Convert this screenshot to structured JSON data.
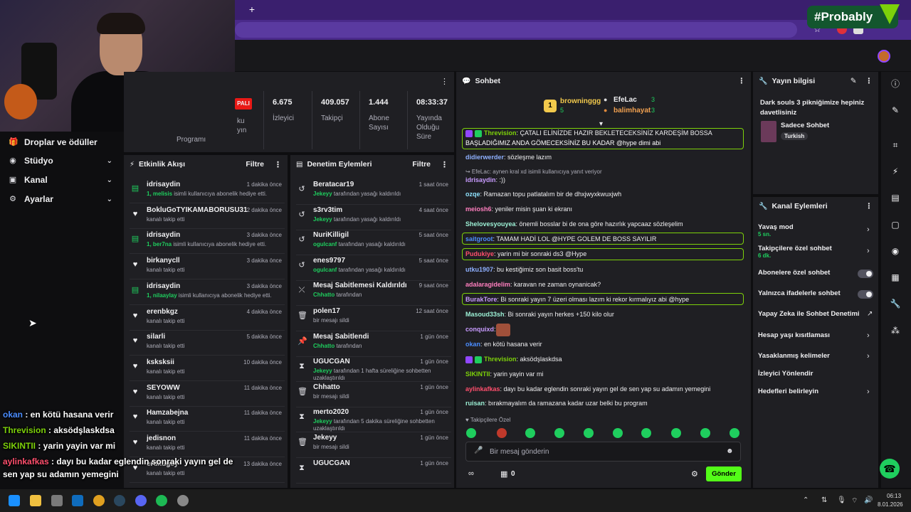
{
  "browser": {
    "new_tab_label": "+"
  },
  "brand_overlay": {
    "text": "#Probably"
  },
  "nav": [
    {
      "label": "Droplar ve ödüller",
      "icon": "gift-icon"
    },
    {
      "label": "Stüdyo",
      "icon": "camera-icon"
    },
    {
      "label": "Kanal",
      "icon": "channel-icon"
    },
    {
      "label": "Ayarlar",
      "icon": "gear-icon"
    }
  ],
  "overlay_chat": [
    {
      "user": "okan",
      "text": " : en kötü hasana verir",
      "color": "#4b8dff"
    },
    {
      "user": "Threvision",
      "text": " : aksödşlaskdsa",
      "color": "#7dd10a"
    },
    {
      "user": "SIKINTII",
      "text": " : yarin yayin var mi",
      "color": "#7dd10a"
    },
    {
      "user": "aylinkafkas",
      "text": " : dayı bu kadar eglendin sonraki yayın gel de",
      "color": "#ff4f6d"
    },
    {
      "user": "",
      "text": "sen yap su adamın yemegini",
      "color": "#fff"
    }
  ],
  "stats": {
    "status": "PALI",
    "status_sub1": "ku",
    "status_sub2": "yın",
    "program": "Programı",
    "items": [
      {
        "value": "6.675",
        "label": "İzleyici"
      },
      {
        "value": "409.057",
        "label": "Takipçi"
      },
      {
        "value": "1.444",
        "label": "Abone Sayısı"
      },
      {
        "value": "08:33:37",
        "label": "Yayında Olduğu Süre"
      }
    ]
  },
  "activity": {
    "title": "Etkinlik Akışı",
    "filter": "Filtre",
    "items": [
      {
        "name": "idrisaydin",
        "time": "1 dakika önce",
        "hl": "1, melisis",
        "desc": " isimli kullanıcıya abonelik hediye etti.",
        "type": "gift"
      },
      {
        "name": "BokluGoTYIKAMABORUSU31",
        "time": "2 dakika önce",
        "hl": "",
        "desc": "kanalı takip etti",
        "type": "heart"
      },
      {
        "name": "idrisaydin",
        "time": "3 dakika önce",
        "hl": "1, ber7na",
        "desc": " isimli kullanıcıya abonelik hediye etti.",
        "type": "gift"
      },
      {
        "name": "birkanycll",
        "time": "3 dakika önce",
        "hl": "",
        "desc": "kanalı takip etti",
        "type": "heart"
      },
      {
        "name": "idrisaydin",
        "time": "3 dakika önce",
        "hl": "1, nilaaylay",
        "desc": " isimli kullanıcıya abonelik hediye etti.",
        "type": "gift"
      },
      {
        "name": "erenbkgz",
        "time": "4 dakika önce",
        "hl": "",
        "desc": "kanalı takip etti",
        "type": "heart"
      },
      {
        "name": "silarli",
        "time": "5 dakika önce",
        "hl": "",
        "desc": "kanalı takip etti",
        "type": "heart"
      },
      {
        "name": "ksksksii",
        "time": "10 dakika önce",
        "hl": "",
        "desc": "kanalı takip etti",
        "type": "heart"
      },
      {
        "name": "SEYOWW",
        "time": "11 dakika önce",
        "hl": "",
        "desc": "kanalı takip etti",
        "type": "heart"
      },
      {
        "name": "Hamzabejna",
        "time": "11 dakika önce",
        "hl": "",
        "desc": "kanalı takip etti",
        "type": "heart"
      },
      {
        "name": "jedisnon",
        "time": "11 dakika önce",
        "hl": "",
        "desc": "kanalı takip etti",
        "type": "heart"
      },
      {
        "name": "erdkugsy",
        "time": "13 dakika önce",
        "hl": "",
        "desc": "kanalı takip etti",
        "type": "heart"
      }
    ]
  },
  "mod": {
    "title": "Denetim Eylemleri",
    "filter": "Filtre",
    "items": [
      {
        "name": "Beratacar19",
        "time": "1 saat önce",
        "by": "Jekeyy",
        "desc": " tarafından yasağı kaldırıldı",
        "icon": "undo-icon"
      },
      {
        "name": "s3rv3tim",
        "time": "4 saat önce",
        "by": "Jekeyy",
        "desc": " tarafından yasağı kaldırıldı",
        "icon": "undo-icon"
      },
      {
        "name": "NuriKilligil",
        "time": "5 saat önce",
        "by": "ogulcanf",
        "desc": " tarafından yasağı kaldırıldı",
        "icon": "undo-icon"
      },
      {
        "name": "enes9797",
        "time": "5 saat önce",
        "by": "ogulcanf",
        "desc": " tarafından yasağı kaldırıldı",
        "icon": "undo-icon"
      },
      {
        "name": "Mesaj Sabitlemesi Kaldırıldı",
        "time": "9 saat önce",
        "by": "Chhatto",
        "desc": " tarafından",
        "icon": "unpin-icon"
      },
      {
        "name": "polen17",
        "time": "12 saat önce",
        "by": "",
        "desc": "bir mesajı sildi",
        "icon": "trash-icon"
      },
      {
        "name": "Mesaj Sabitlendi",
        "time": "1 gün önce",
        "by": "Chhatto",
        "desc": " tarafından",
        "icon": "pin-icon"
      },
      {
        "name": "UGUCGAN",
        "time": "1 gün önce",
        "by": "Jekeyy",
        "desc": " tarafından 1 hafta süreliğine sohbetten uzaklaştırıldı",
        "icon": "hourglass-icon"
      },
      {
        "name": "Chhatto",
        "time": "1 gün önce",
        "by": "",
        "desc": "bir mesajı sildi",
        "icon": "trash-icon"
      },
      {
        "name": "merto2020",
        "time": "1 gün önce",
        "by": "Jekeyy",
        "desc": " tarafından 5 dakika süreliğine sohbetten uzaklaştırıldı",
        "icon": "hourglass-icon"
      },
      {
        "name": "Jekeyy",
        "time": "1 gün önce",
        "by": "",
        "desc": "bir mesajı sildi",
        "icon": "trash-icon"
      },
      {
        "name": "UGUCGAN",
        "time": "1 gün önce",
        "by": "",
        "desc": "",
        "icon": "hourglass-icon"
      }
    ]
  },
  "chat": {
    "title": "Sohbet",
    "top_gifters": [
      {
        "name": "browninggg",
        "count": "5",
        "rank": "1"
      },
      {
        "name": "EfeLac",
        "count": "3"
      },
      {
        "name": "balimhayat",
        "count": "3"
      }
    ],
    "messages": [
      {
        "user": "Threvision",
        "color": "#7dd10a",
        "text": ": ÇATALI ELİNİZDE HAZIR BEKLETECEKSİNİZ KARDEŞİM BOSSA",
        "hl": true
      },
      {
        "user": "",
        "color": "#fff",
        "text": "BAŞLADIĞIMIZ ANDA GÖMECEKSİNİZ BU KADAR @hype dimi abi",
        "hl": true
      },
      {
        "user": "didierwerder",
        "color": "#8fb0ff",
        "text": ": sözleşme lazım"
      },
      {
        "user": "",
        "color": "#adadb8",
        "text": "↪ EfeLac: aynen kral xd isimli kullanıcıya yanıt veriyor",
        "small": true
      },
      {
        "user": "idrisaydin",
        "color": "#c89bff",
        "text": ": :))"
      },
      {
        "user": "ozqe",
        "color": "#8fe3ff",
        "text": ": Ramazan topu patlatalım bir de dhxjwyxkwuxjwh"
      },
      {
        "user": "meiosh6",
        "color": "#ff7fbf",
        "text": ": yeniler misin şuan ki ekranı"
      },
      {
        "user": "Shelovesyouyea",
        "color": "#9cf0d5",
        "text": ": önemli bosslar bi de ona göre hazırlık yapcaaz sözleşelim"
      },
      {
        "user": "saitgroot",
        "color": "#4b8dff",
        "text": ": TAMAM HADİ LOL @HYPE GOLEM DE BOSS SAYILIR",
        "hl": true
      },
      {
        "user": "Pudukiye",
        "color": "#ff4f6d",
        "text": ": yarin mi bir sonraki ds3 @Hype",
        "hl": true
      },
      {
        "user": "utku1907",
        "color": "#8fb0ff",
        "text": ": bu kestiğimiz son basit boss'tu"
      },
      {
        "user": "adalaragidelim",
        "color": "#ff7fbf",
        "text": ": karavan ne zaman oynanicak?"
      },
      {
        "user": "BurakTore",
        "color": "#c89bff",
        "text": ": Bi sonraki yayın 7 üzeri olması lazım ki rekor kırmalıyız abi @hype",
        "hl": true
      },
      {
        "user": "Masoud33sh",
        "color": "#9cf0d5",
        "text": ": Bi sonraki yayın herkes +150 kilo olur"
      },
      {
        "user": "conquixd",
        "color": "#c89bff",
        "text": ":"
      },
      {
        "user": "okan",
        "color": "#4b8dff",
        "text": ": en kötü hasana verir"
      },
      {
        "user": "Threvision",
        "color": "#7dd10a",
        "text": ": aksödşlaskdsa"
      },
      {
        "user": "SIKINTII",
        "color": "#7dd10a",
        "text": ": yarin yayin var mi"
      },
      {
        "user": "aylinkafkas",
        "color": "#ff4f6d",
        "text": ": dayı bu kadar eglendin sonraki yayın gel de sen yap su adamın yemegini"
      },
      {
        "user": "ruisan",
        "color": "#9cf0d5",
        "text": ": bırakmayalım da ramazana kadar uzar belki bu program"
      }
    ],
    "followers_only": "Takipçilere Özel",
    "input_placeholder": "Bir mesaj gönderin",
    "points": "0",
    "send_label": "Gönder"
  },
  "stream_info": {
    "title": "Yayın bilgisi",
    "stream_title": "Dark souls 3 pikniğimize hepiniz davetlisiniz",
    "category": "Sadece Sohbet",
    "tag": "Turkish"
  },
  "channel_actions": {
    "title": "Kanal Eylemleri",
    "items": [
      {
        "label": "Yavaş mod",
        "sub": "5 sn.",
        "ctrl": "chevron"
      },
      {
        "label": "Takipçilere özel sohbet",
        "sub": "6 dk.",
        "ctrl": "chevron"
      },
      {
        "label": "Abonelere özel sohbet",
        "sub": "",
        "ctrl": "toggle"
      },
      {
        "label": "Yalnızca ifadelerle sohbet",
        "sub": "",
        "ctrl": "toggle"
      },
      {
        "label": "Yapay Zeka ile Sohbet Denetimi",
        "sub": "",
        "ctrl": "external"
      },
      {
        "label": "Hesap yaşı kısıtlaması",
        "sub": "",
        "ctrl": "chevron"
      },
      {
        "label": "Yasaklanmış kelimeler",
        "sub": "",
        "ctrl": "chevron"
      },
      {
        "label": "İzleyici Yönlendir",
        "sub": "",
        "ctrl": "none"
      },
      {
        "label": "Hedefleri belirleyin",
        "sub": "",
        "ctrl": "chevron"
      }
    ]
  },
  "taskbar": {
    "time": "06:13",
    "date": "8.01.2026"
  },
  "colors": {
    "accent": "#1fce5e",
    "purple": "#9147ff",
    "panel": "#1f1f23"
  }
}
